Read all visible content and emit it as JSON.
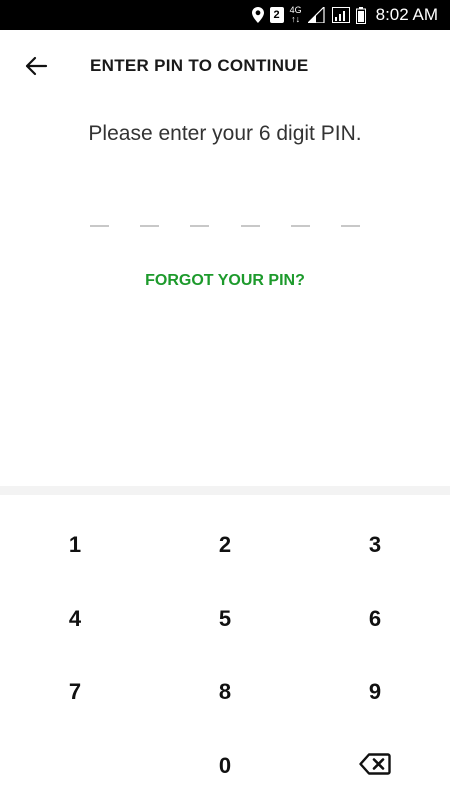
{
  "status_bar": {
    "sim_number": "2",
    "network_type_top": "4G",
    "network_type_bottom": "↑↓",
    "time": "8:02 AM"
  },
  "header": {
    "back_icon": "arrow-left-icon",
    "title": "ENTER PIN TO CONTINUE"
  },
  "prompt": "Please enter your 6 digit PIN.",
  "pin": {
    "length": 6,
    "entered": 0
  },
  "forgot_pin": "FORGOT YOUR PIN?",
  "keypad": {
    "keys": [
      "1",
      "2",
      "3",
      "4",
      "5",
      "6",
      "7",
      "8",
      "9",
      "0"
    ],
    "backspace_icon": "backspace-icon"
  },
  "colors": {
    "accent": "#1d9a2c",
    "status_bar": "#000000",
    "pin_dash": "#c8c8c8",
    "divider": "#f3f3f3"
  }
}
